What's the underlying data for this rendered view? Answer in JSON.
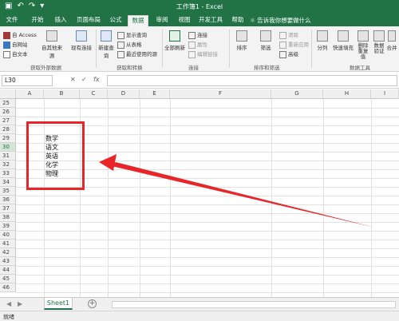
{
  "window": {
    "title": "工作簿1 - Excel"
  },
  "ribbon_tabs": [
    "文件",
    "开始",
    "插入",
    "页面布局",
    "公式",
    "数据",
    "审阅",
    "视图",
    "开发工具",
    "帮助"
  ],
  "active_tab": "数据",
  "tell_me": "告诉我你想要做什么",
  "ribbon": {
    "get_external": {
      "access": "自 Access",
      "web": "自网站",
      "text": "自文本",
      "other": "自其他来源",
      "existing": "现有连接",
      "label": "获取外部数据"
    },
    "get_transform": {
      "new_query": "新建查询",
      "show_queries": "显示查询",
      "from_table": "从表格",
      "recent": "最近使用的源",
      "label": "获取和转换"
    },
    "connections": {
      "refresh_all": "全部刷新",
      "connections": "连接",
      "properties": "属性",
      "edit_links": "编辑链接",
      "label": "连接"
    },
    "sort_filter": {
      "sort": "排序",
      "filter": "筛选",
      "clear": "清除",
      "reapply": "重新应用",
      "advanced": "高级",
      "label": "排序和筛选"
    },
    "data_tools": {
      "split": "分列",
      "flash_fill": "快速填充",
      "remove_dup": "删除重复值",
      "validation": "数据验证",
      "consolidate": "合并",
      "label": "数据工具"
    }
  },
  "formula_bar": {
    "name_box": "L30",
    "cancel": "✕",
    "enter": "✓",
    "fx": "fx",
    "value": ""
  },
  "columns": [
    "A",
    "B",
    "C",
    "D",
    "E",
    "F",
    "G",
    "H",
    "I"
  ],
  "rows": [
    "25",
    "26",
    "27",
    "28",
    "29",
    "30",
    "31",
    "32",
    "33",
    "34",
    "35",
    "36",
    "37",
    "38",
    "39",
    "40",
    "41",
    "42",
    "43",
    "44",
    "45",
    "46"
  ],
  "selected_row": "30",
  "cells": {
    "B29": "数学",
    "B30": "语文",
    "B31": "英语",
    "B32": "化学",
    "B33": "物理"
  },
  "sheet_tabs": [
    "Sheet1"
  ],
  "status": "就绪",
  "colors": {
    "excel_green": "#217346",
    "annotation_red": "#e8262a"
  }
}
